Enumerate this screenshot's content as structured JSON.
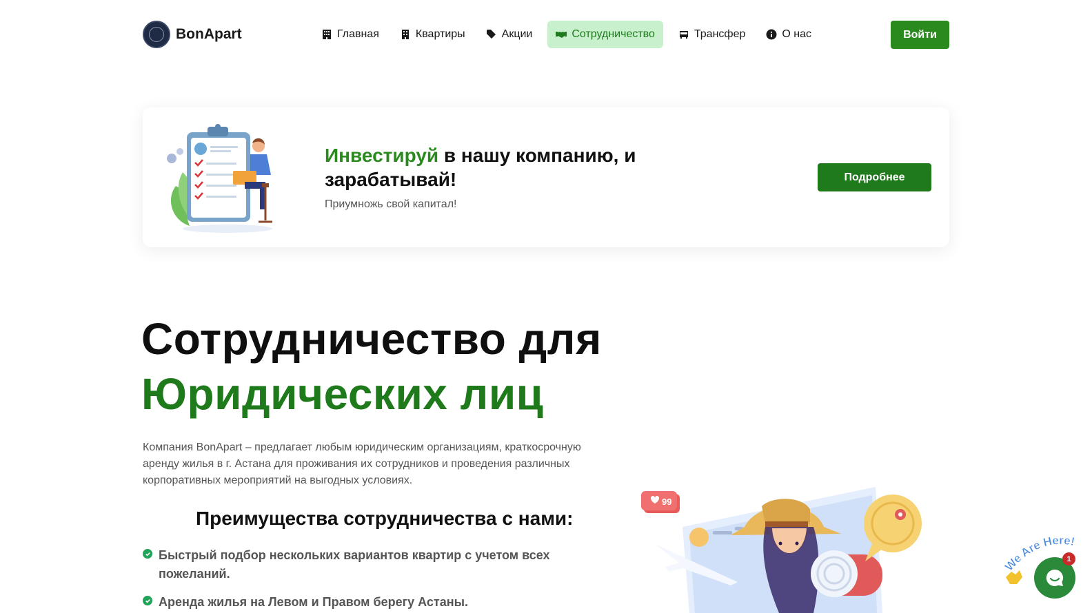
{
  "brand": {
    "name": "BonApart"
  },
  "nav": {
    "items": [
      {
        "label": "Главная",
        "icon": "building-icon"
      },
      {
        "label": "Квартиры",
        "icon": "apartment-icon"
      },
      {
        "label": "Акции",
        "icon": "tags-icon"
      },
      {
        "label": "Сотрудничество",
        "icon": "handshake-icon",
        "active": true
      },
      {
        "label": "Трансфер",
        "icon": "bus-icon"
      },
      {
        "label": "О нас",
        "icon": "info-icon"
      }
    ],
    "login_label": "Войти"
  },
  "invest": {
    "title_accent": "Инвестируй",
    "title_rest": " в нашу компанию, и зарабатывай!",
    "subtitle": "Приумножь свой капитал!",
    "button_label": "Подробнее"
  },
  "hero": {
    "title_line1": "Сотрудничество для",
    "title_line2": "Юридических лиц",
    "description": "Компания BonApart – предлагает любым юридическим организациям, краткосрочную аренду жилья в г. Астана для проживания их сотрудников и проведения различных корпоративных мероприятий на выгодных условиях.",
    "benefits_title": "Преимущества сотрудничества с нами:",
    "benefits": [
      "Быстрый подбор нескольких вариантов квартир с учетом всех пожеланий.",
      "Аренда жилья на Левом и Правом берегу Астаны."
    ]
  },
  "illustration": {
    "likes": "99"
  },
  "chat": {
    "tagline": "We Are Here!",
    "unread": "1"
  },
  "colors": {
    "accent": "#2a8a1e",
    "active_bg": "#c9f0cc",
    "check": "#22a35a"
  }
}
